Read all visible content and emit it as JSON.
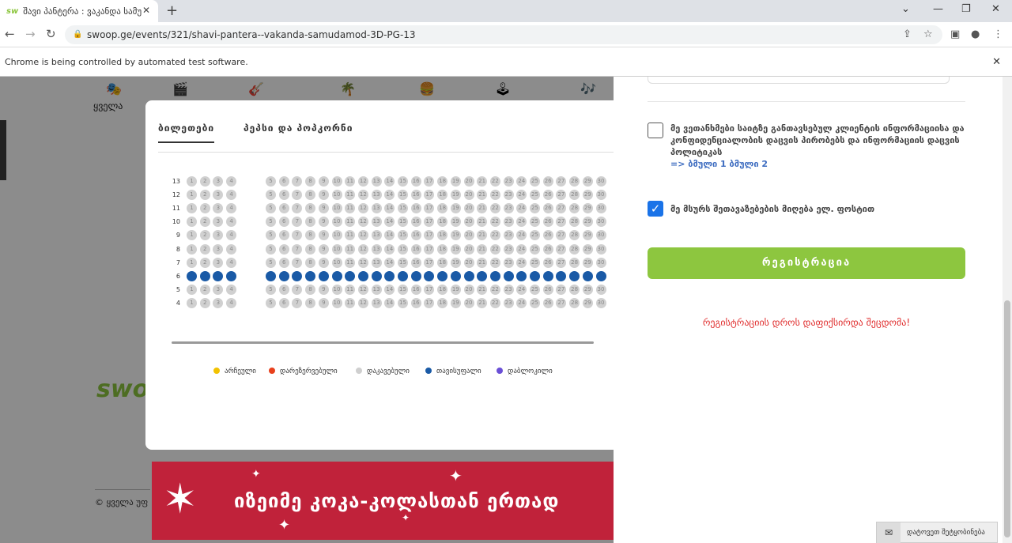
{
  "browser": {
    "tab_title": "შავი პანტერა : ვაკანდა სამუ",
    "tab_favicon": "sw",
    "url": "swoop.ge/events/321/shavi-pantera--vakanda-samudamod-3D-PG-13",
    "infobar_text": "Chrome is being controlled by automated test software."
  },
  "page": {
    "category_label": "ყველა",
    "footer_logo": "swoo",
    "footer_copy": "© ყველა უფ",
    "banner_text": "იზეიმე კოკა-კოლასთან ერთად"
  },
  "modal": {
    "tabs": [
      "ბილეთები",
      "პეპსი და პოპკორნი"
    ],
    "rows": [
      {
        "label": "13",
        "status": "taken"
      },
      {
        "label": "12",
        "status": "taken"
      },
      {
        "label": "11",
        "status": "taken"
      },
      {
        "label": "10",
        "status": "taken"
      },
      {
        "label": "9",
        "status": "taken"
      },
      {
        "label": "8",
        "status": "taken"
      },
      {
        "label": "7",
        "status": "taken"
      },
      {
        "label": "6",
        "status": "free"
      },
      {
        "label": "5",
        "status": "taken"
      },
      {
        "label": "4",
        "status": "taken"
      }
    ],
    "seats_left": [
      "1",
      "2",
      "3",
      "4"
    ],
    "seats_right": [
      "5",
      "6",
      "7",
      "8",
      "9",
      "10",
      "11",
      "12",
      "13",
      "14",
      "15",
      "16",
      "17",
      "18",
      "19",
      "20",
      "21",
      "22",
      "23",
      "24",
      "25",
      "26",
      "27",
      "28",
      "29",
      "30"
    ],
    "legend": [
      {
        "label": "არჩეული",
        "color": "#f2c200"
      },
      {
        "label": "დარეზერვებული",
        "color": "#e8401c"
      },
      {
        "label": "დაკავებული",
        "color": "#cfcfcf"
      },
      {
        "label": "თავისუფალი",
        "color": "#1a5aa6"
      },
      {
        "label": "დაბლოკილი",
        "color": "#6a4fd6"
      }
    ]
  },
  "panel": {
    "terms_text": "მე ვეთანხმები საიტზე განთავსებულ კლიენტის ინფორმაციისა და კონფიდენციალობის დაცვის პირობებს და ინფორმაციის დაცვის პოლიტიკას",
    "terms_links": "=> ბმული 1 ბმული 2",
    "promo_text": "მე მსურს შეთავაზებების მიღება ელ. ფოსტით",
    "register_button": "რეგისტრაცია",
    "error_text": "რეგისტრაციის დროს დაფიქსირდა შეცდომა!",
    "feedback_label": "დატოვეთ შეტყობინება"
  },
  "colors": {
    "accent_green": "#8dc63f",
    "free_seat": "#1a5aa6",
    "error_red": "#e02d2d"
  }
}
